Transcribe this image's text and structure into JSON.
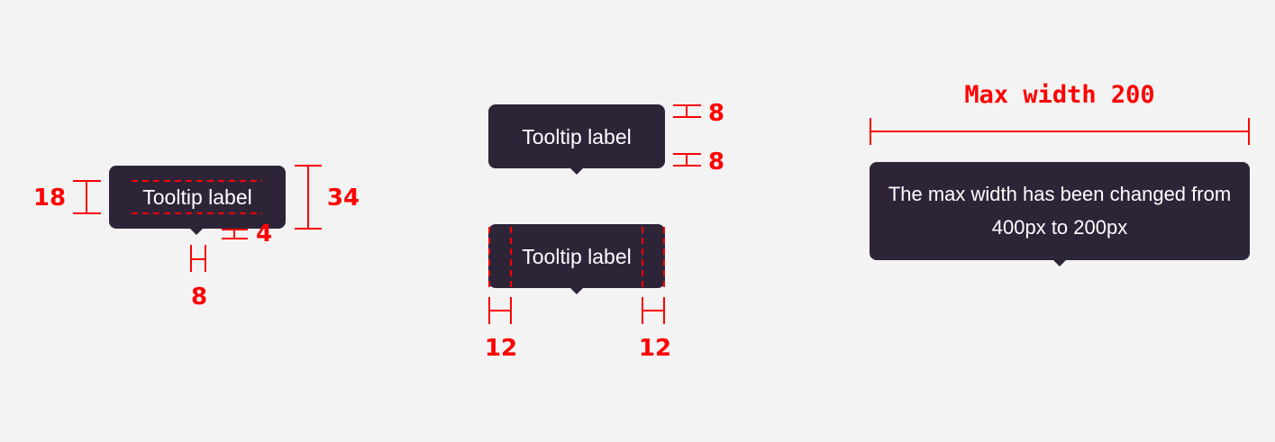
{
  "tooltips": {
    "height_example": {
      "label": "Tooltip label"
    },
    "vertical_padding_example": {
      "label": "Tooltip label"
    },
    "horizontal_padding_example": {
      "label": "Tooltip label"
    },
    "max_width_example": {
      "label": "The max width has been changed from 400px to 200px"
    }
  },
  "annotations": {
    "text_height": "18",
    "tooltip_height": "34",
    "arrow_gap": "4",
    "arrow_width": "8",
    "padding_top": "8",
    "padding_bottom": "8",
    "padding_left": "12",
    "padding_right": "12",
    "max_width_title": "Max width 200"
  },
  "colors": {
    "background": "#f3f3f3",
    "tooltip_fill": "#2e2438",
    "tooltip_text": "#ffffff",
    "annotation": "#ff0000"
  }
}
